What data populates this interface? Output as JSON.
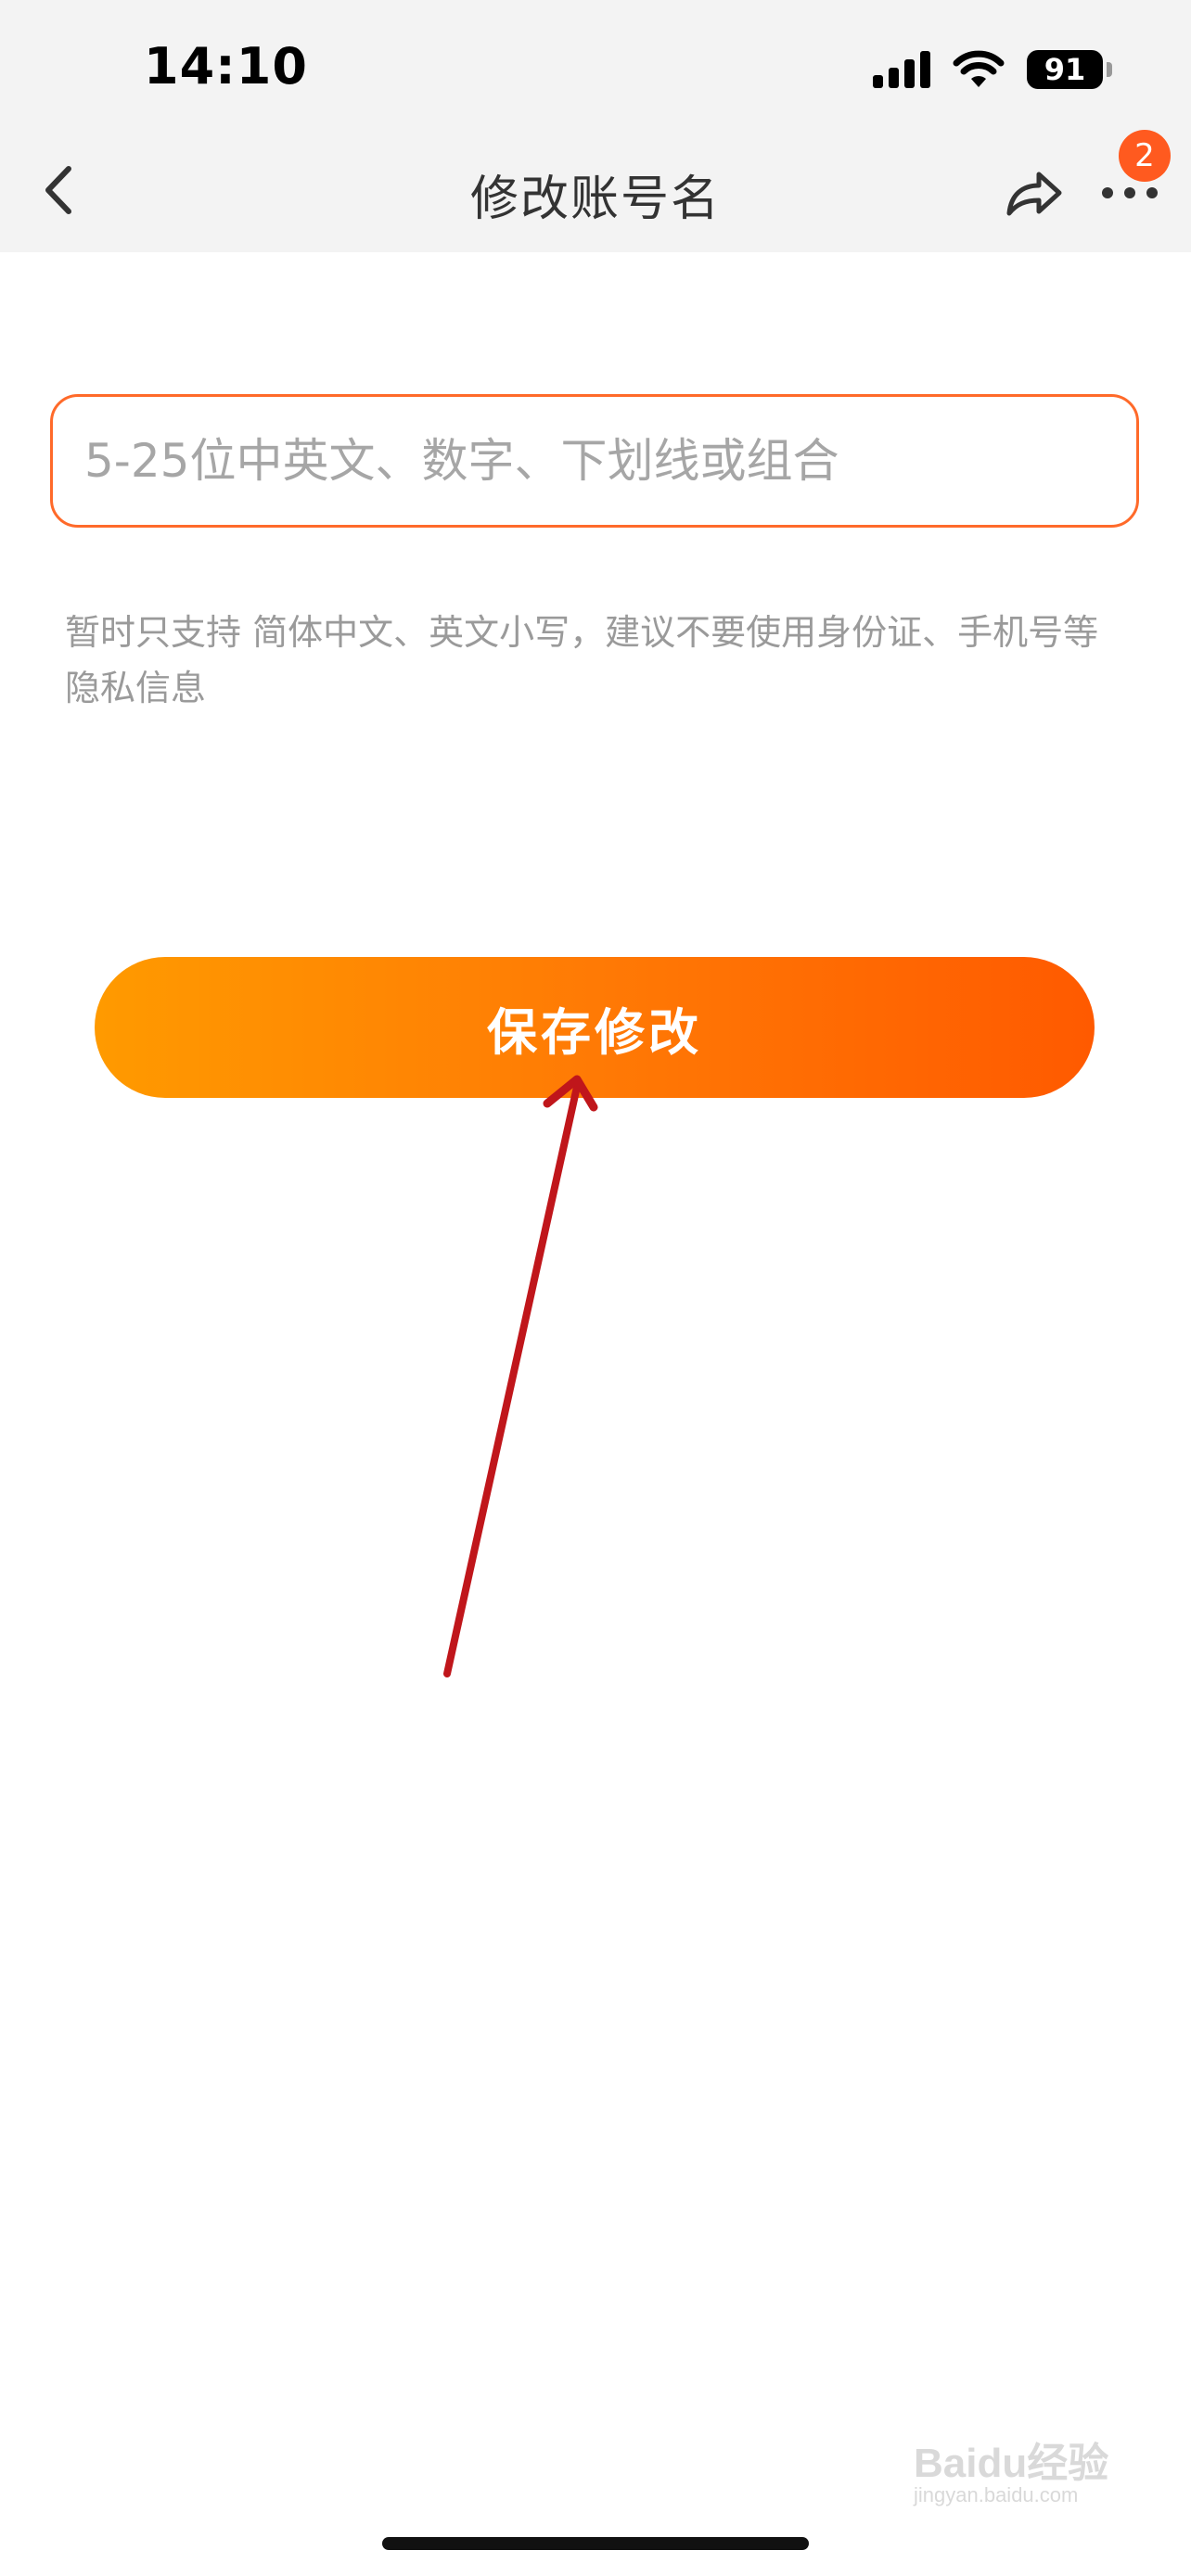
{
  "status_bar": {
    "time": "14:10",
    "battery": "91",
    "icons": [
      "signal-icon",
      "wifi-icon",
      "battery-icon"
    ]
  },
  "nav": {
    "title": "修改账号名",
    "back_icon": "chevron-left-icon",
    "share_icon": "share-icon",
    "more_icon": "more-dots-icon",
    "badge_count": "2"
  },
  "form": {
    "name_input": {
      "value": "",
      "placeholder": "5-25位中英文、数字、下划线或组合"
    },
    "hint": "暂时只支持 简体中文、英文小写，建议不要使用身份证、手机号等隐私信息",
    "save_label": "保存修改"
  },
  "watermark": {
    "text": "Baidu经验",
    "sub": "jingyan.baidu.com"
  },
  "colors": {
    "accent": "#ff6a2a",
    "button_start": "#ff9a00",
    "button_end": "#ff5a00",
    "badge": "#ff5a1f",
    "annotation_arrow": "#c0161b"
  }
}
